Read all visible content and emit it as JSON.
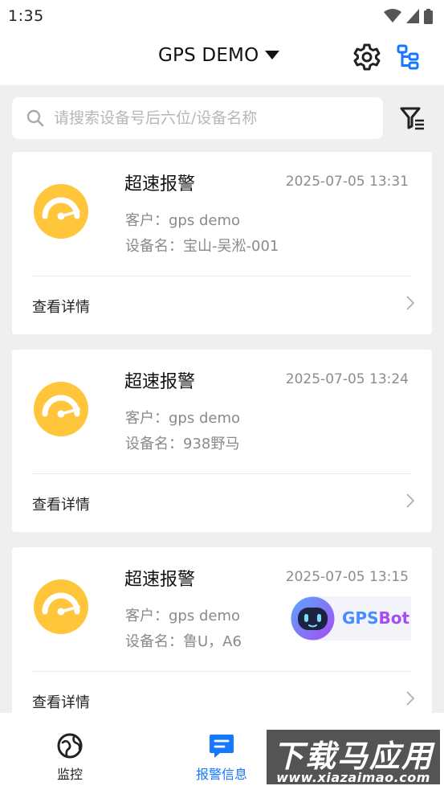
{
  "status_bar": {
    "time": "1:35"
  },
  "header": {
    "title": "GPS DEMO"
  },
  "search": {
    "placeholder": "请搜索设备号后六位/设备名称",
    "value": ""
  },
  "alarms": [
    {
      "title": "超速报警",
      "time": "2025-07-05 13:31",
      "customer": "客户：gps demo",
      "device": "设备名：宝山-吴淞-001",
      "detail_label": "查看详情"
    },
    {
      "title": "超速报警",
      "time": "2025-07-05 13:24",
      "customer": "客户：gps demo",
      "device": "设备名：938野马",
      "detail_label": "查看详情"
    },
    {
      "title": "超速报警",
      "time": "2025-07-05 13:15",
      "customer": "客户：gps demo",
      "device": "设备名：鲁U，A6",
      "detail_label": "查看详情"
    }
  ],
  "float_button": {
    "label_prefix": "GPS",
    "label_suffix": "Bot"
  },
  "bottom_nav": [
    {
      "label": "监控",
      "icon": "monitor-icon",
      "active": false
    },
    {
      "label": "报警信息",
      "icon": "alarm-message-icon",
      "active": true
    }
  ],
  "watermark": {
    "title": "下载马应用",
    "url": "www.xiazaimao.com"
  },
  "colors": {
    "accent": "#1677ff",
    "alarm_yellow": "#ffc63c",
    "header_icon_blue": "#1677ff",
    "bot_purple": "#a64cf0"
  }
}
